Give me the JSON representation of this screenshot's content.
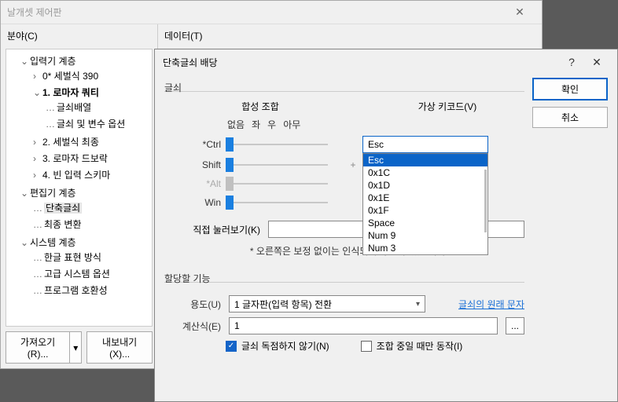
{
  "main": {
    "title": "날개셋 제어판",
    "left_label": "분야(C)",
    "right_label": "데이터(T)",
    "tree": {
      "n0": "입력기 계층",
      "n00": "0* 세벌식 390",
      "n01": "1. 로마자 쿼티",
      "n010": "글쇠배열",
      "n011": "글쇠 및 변수 옵션",
      "n02": "2. 세벌식 최종",
      "n03": "3. 로마자 드보락",
      "n04": "4. 빈 입력 스키마",
      "n1": "편집기 계층",
      "n10": "단축글쇠",
      "n11": "최종 변환",
      "n2": "시스템 계층",
      "n20": "한글 표현 방식",
      "n21": "고급 시스템 옵션",
      "n22": "프로그램 호환성"
    },
    "import_btn": "가져오기(R)...",
    "import_arrow": "▾",
    "export_btn": "내보내기(X)..."
  },
  "dialog": {
    "title": "단축글쇠 배당",
    "ok": "확인",
    "cancel": "취소",
    "group_key": "글쇠",
    "combo_label": "합성 조합",
    "vk_label": "가상 키코드(V)",
    "hdr_none": "없음",
    "hdr_left": "좌",
    "hdr_right": "우",
    "hdr_any": "아무",
    "mod_ctrl": "*Ctrl",
    "mod_shift": "Shift",
    "mod_alt": "*Alt",
    "mod_win": "Win",
    "plus": "+",
    "vk_value": "Esc",
    "vk_items": [
      "Esc",
      "0x1C",
      "0x1D",
      "0x1E",
      "0x1F",
      "Space",
      "Num 9",
      "Num 3"
    ],
    "press_label": "직접 눌러보기(K)",
    "note": "* 오른쪽은 보정 없이는 인식되지 않을 수 있습니다.",
    "group_func": "할당할 기능",
    "purpose_label": "용도(U)",
    "purpose_value": "1 글자판(입력 항목) 전환",
    "orig_link": "글쇠의 원래 문자",
    "expr_label": "계산식(E)",
    "expr_value": "1",
    "dots": "...",
    "chk1": "글쇠 독점하지 않기(N)",
    "chk2": "조합 중일 때만 동작(I)",
    "help": "?",
    "close": "✕"
  }
}
